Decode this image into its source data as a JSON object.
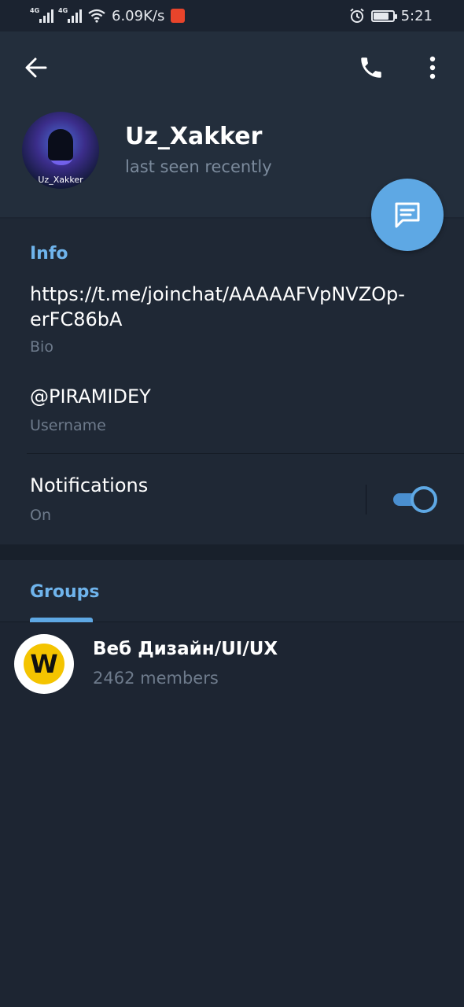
{
  "status_bar": {
    "network_1": "4G",
    "network_2": "4G",
    "speed": "6.09K/s",
    "time": "5:21",
    "battery_level": 0.8,
    "icons": [
      "signal-icon",
      "signal-icon",
      "wifi-icon",
      "app-notification-icon",
      "alarm-icon",
      "battery-icon"
    ]
  },
  "header": {
    "name": "Uz_Xakker",
    "status": "last seen recently",
    "avatar_label": "Uz_Xakker",
    "icons": [
      "back-arrow-icon",
      "phone-icon",
      "more-vertical-icon",
      "message-icon"
    ]
  },
  "info": {
    "title": "Info",
    "bio_value": "https://t.me/joinchat/AAAAAFVpNVZOp-erFC86bA",
    "bio_label": "Bio",
    "username_value": "@PIRAMIDEY",
    "username_label": "Username",
    "notifications_label": "Notifications",
    "notifications_state": "On",
    "notifications_enabled": true
  },
  "tabs": {
    "groups_label": "Groups"
  },
  "groups": [
    {
      "avatar_letter": "W",
      "name": "Веб Дизайн/UI/UX",
      "members": "2462 members"
    }
  ],
  "colors": {
    "accent": "#5ea8e4",
    "accent_text": "#6fb4ec",
    "background": "#1d2532",
    "header_bg": "#232e3c",
    "section_bg": "#1f2835",
    "secondary_text": "#6e7b8c"
  }
}
